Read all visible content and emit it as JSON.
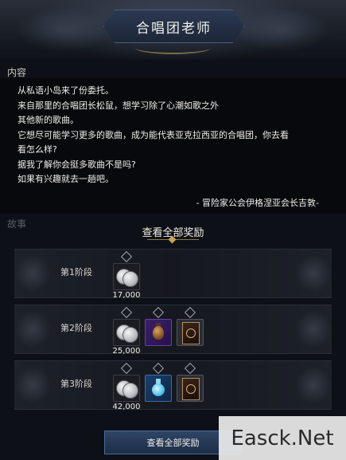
{
  "header": {
    "title": "合唱团老师"
  },
  "content": {
    "label": "内容",
    "lines": [
      "从私语小岛来了份委托。",
      "来自那里的合唱团长松鼠，想学习除了心潮如歌之外",
      "其他新的歌曲。",
      "它想尽可能学习更多的歌曲，成为能代表亚克拉西亚的合唱团，你去看",
      "看怎么样?",
      "据我了解你会挺多歌曲不是吗?",
      "如果有兴趣就去一趟吧。"
    ],
    "signature": "- 冒险家公会伊格涅亚会长吉敦-"
  },
  "story": {
    "label": "故事"
  },
  "rewards": {
    "title": "查看全部奖励",
    "stages": [
      {
        "label": "第1阶段",
        "amount": "17,000",
        "items": [
          "silver-coin-icon"
        ]
      },
      {
        "label": "第2阶段",
        "amount": "25,000",
        "items": [
          "silver-coin-icon",
          "bomb-icon",
          "card-icon"
        ]
      },
      {
        "label": "第3阶段",
        "amount": "42,000",
        "items": [
          "silver-coin-icon",
          "potion-icon",
          "card-icon"
        ]
      }
    ]
  },
  "footer": {
    "button_label": "查看全部奖励"
  },
  "watermark": {
    "text": "Easck.Net"
  }
}
